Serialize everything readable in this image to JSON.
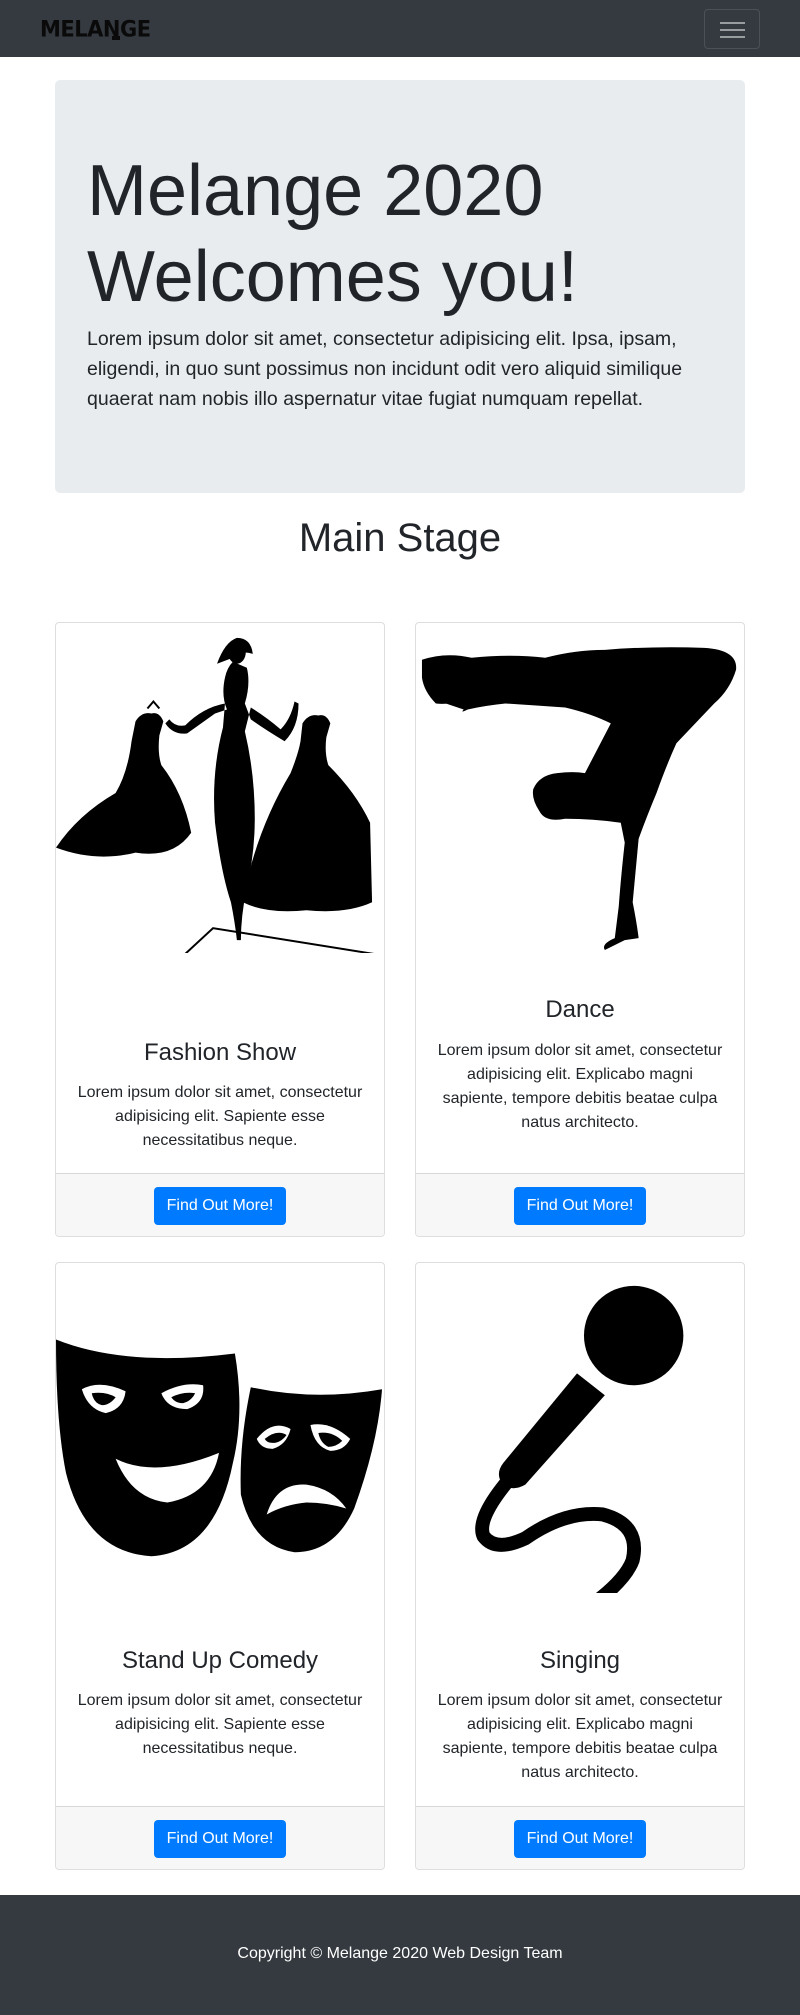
{
  "navbar": {
    "brand": "MELANGE",
    "toggle_icon": "hamburger-menu-icon"
  },
  "hero": {
    "title": "Melange 2020 Welcomes you!",
    "lead": "Lorem ipsum dolor sit amet, consectetur adipisicing elit. Ipsa, ipsam, eligendi, in quo sunt possimus non incidunt odit vero aliquid similique quaerat nam nobis illo aspernatur vitae fugiat numquam repellat."
  },
  "section": {
    "title": "Main Stage"
  },
  "cards": [
    {
      "title": "Fashion Show",
      "image_icon": "fashion-silhouette-icon",
      "text": "Lorem ipsum dolor sit amet, consectetur adipisicing elit. Sapiente esse necessitatibus neque.",
      "button": "Find Out More!"
    },
    {
      "title": "Dance",
      "image_icon": "breakdancer-icon",
      "text": "Lorem ipsum dolor sit amet, consectetur adipisicing elit. Explicabo magni sapiente, tempore debitis beatae culpa natus architecto.",
      "button": "Find Out More!"
    },
    {
      "title": "Stand Up Comedy",
      "image_icon": "theater-masks-icon",
      "text": "Lorem ipsum dolor sit amet, consectetur adipisicing elit. Sapiente esse necessitatibus neque.",
      "button": "Find Out More!"
    },
    {
      "title": "Singing",
      "image_icon": "microphone-icon",
      "text": "Lorem ipsum dolor sit amet, consectetur adipisicing elit. Explicabo magni sapiente, tempore debitis beatae culpa natus architecto.",
      "button": "Find Out More!"
    }
  ],
  "footer": {
    "copyright": "Copyright © Melange 2020 Web Design Team"
  },
  "colors": {
    "navbar_bg": "#343a40",
    "jumbotron_bg": "#e9ecef",
    "button_primary": "#007bff",
    "card_footer_bg": "#f7f7f7"
  }
}
